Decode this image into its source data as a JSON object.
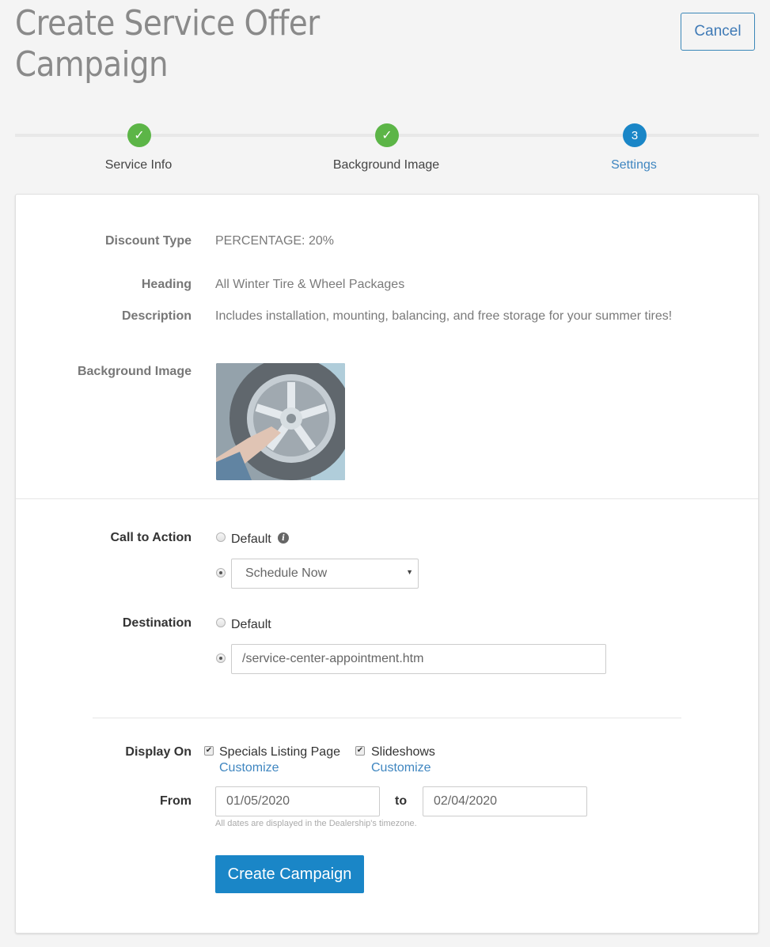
{
  "header": {
    "title_line1": "Create Service Offer",
    "title_line2": "Campaign",
    "cancel_label": "Cancel"
  },
  "stepper": {
    "steps": [
      {
        "label": "Service Info",
        "status": "done",
        "marker": "✓"
      },
      {
        "label": "Background Image",
        "status": "done",
        "marker": "✓"
      },
      {
        "label": "Settings",
        "status": "active",
        "marker": "3"
      }
    ]
  },
  "summary": {
    "discount_type": {
      "label": "Discount Type",
      "value": "PERCENTAGE: 20%"
    },
    "heading": {
      "label": "Heading",
      "value": "All Winter Tire & Wheel Packages"
    },
    "description": {
      "label": "Description",
      "value": "Includes installation, mounting, balancing, and free storage for your summer tires!"
    },
    "background_image": {
      "label": "Background Image",
      "alt": "Mechanic tightening lug nuts on a car wheel"
    }
  },
  "settings": {
    "call_to_action": {
      "label": "Call to Action",
      "default_label": "Default",
      "info_icon": "i",
      "selected": "custom",
      "select_value": "Schedule Now",
      "select_arrow": "▼"
    },
    "destination": {
      "label": "Destination",
      "default_label": "Default",
      "selected": "custom",
      "input_value": "/service-center-appointment.htm"
    },
    "display_on": {
      "label": "Display On",
      "options": [
        {
          "label": "Specials Listing Page",
          "checked": true,
          "link": "Customize"
        },
        {
          "label": "Slideshows",
          "checked": true,
          "link": "Customize"
        }
      ],
      "check_glyph": "✔"
    },
    "dates": {
      "from_label": "From",
      "from_value": "01/05/2020",
      "to_label": "to",
      "to_value": "02/04/2020",
      "hint": "All dates are displayed in the Dealership's timezone."
    },
    "submit_label": "Create Campaign"
  },
  "colors": {
    "primary": "#1a86c7",
    "success": "#5cb547",
    "link": "#3f86c0"
  }
}
